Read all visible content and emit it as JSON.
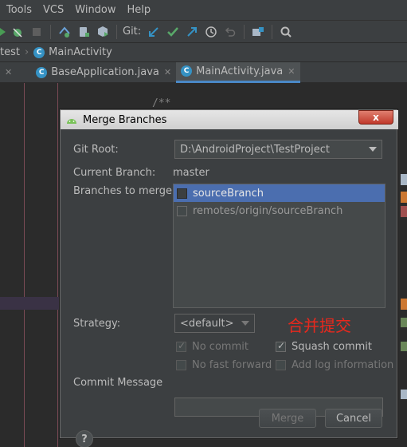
{
  "menubar": {
    "items": [
      "Tools",
      "VCS",
      "Window",
      "Help"
    ]
  },
  "toolbar": {
    "git_label": "Git:"
  },
  "navbar": {
    "crumbs": [
      "test",
      "MainActivity"
    ]
  },
  "tabs": [
    {
      "label": "BaseApplication.java",
      "active": false
    },
    {
      "label": "MainActivity.java",
      "active": true
    }
  ],
  "editor": {
    "comment": "/**"
  },
  "dialog": {
    "title": "Merge Branches",
    "close_label": "x",
    "git_root_label": "Git Root:",
    "git_root_value": "D:\\AndroidProject\\TestProject",
    "current_branch_label": "Current Branch:",
    "current_branch_value": "master",
    "branches_label": "Branches to merge:",
    "branches": [
      {
        "label": "sourceBranch",
        "checked": false,
        "selected": true
      },
      {
        "label": "remotes/origin/sourceBranch",
        "checked": false,
        "selected": false
      }
    ],
    "strategy_label": "Strategy:",
    "strategy_value": "<default>",
    "annotation": "合并提交",
    "options": {
      "no_commit": "No commit",
      "squash_commit": "Squash commit",
      "no_fast_forward": "No fast forward",
      "add_log": "Add log information"
    },
    "commit_message_label": "Commit Message",
    "commit_message_value": "",
    "merge_button": "Merge",
    "cancel_button": "Cancel",
    "help_label": "?"
  },
  "colors": {
    "accent": "#4b6eaf",
    "tab_underline": "#4a88c7",
    "annotation": "#e8281d",
    "close_button": "#c0392b"
  }
}
